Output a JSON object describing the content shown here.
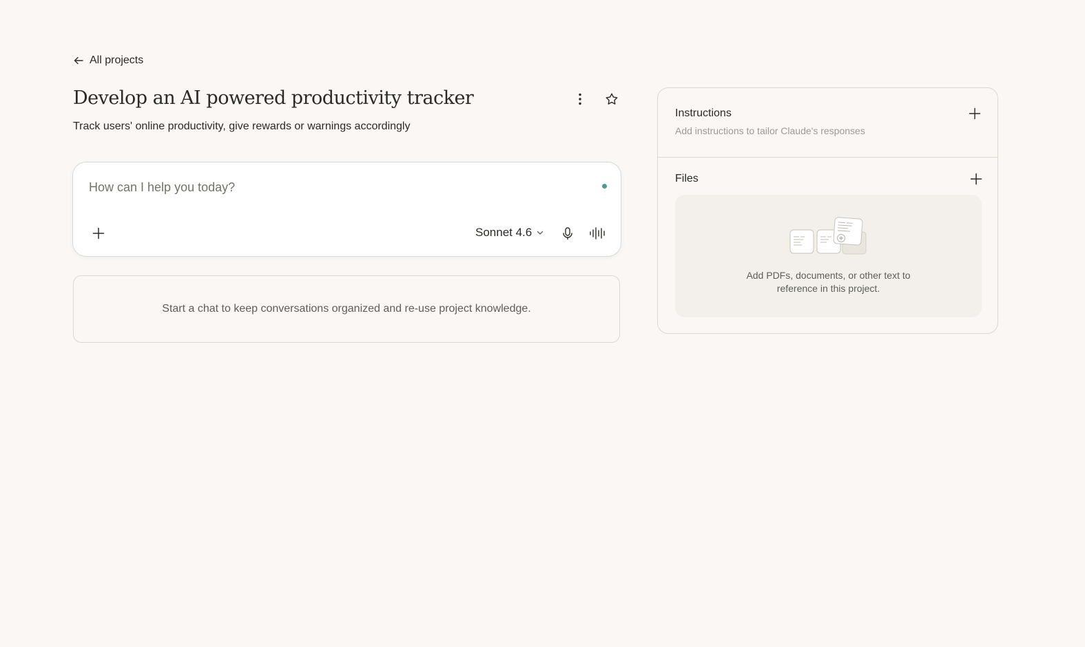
{
  "nav": {
    "back_label": "All projects"
  },
  "project": {
    "title": "Develop an AI powered productivity tracker",
    "description": "Track users' online productivity, give rewards or warnings accordingly"
  },
  "composer": {
    "placeholder": "How can I help you today?",
    "model": "Sonnet 4.6"
  },
  "chats": {
    "empty_text": "Start a chat to keep conversations organized and re-use project knowledge."
  },
  "instructions": {
    "title": "Instructions",
    "subtitle": "Add instructions to tailor Claude's responses"
  },
  "files": {
    "title": "Files",
    "hint_line1": "Add PDFs, documents, or other text to",
    "hint_line2": "reference in this project."
  },
  "colors": {
    "background": "#faf7f5",
    "status_dot": "#4a9b8a",
    "border": "#dcd8d0"
  }
}
